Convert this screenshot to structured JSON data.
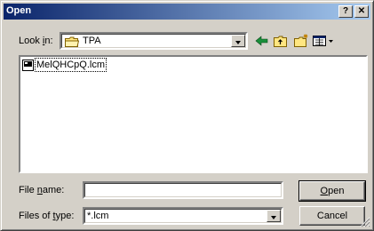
{
  "window": {
    "title": "Open"
  },
  "lookin": {
    "label_prefix": "Look ",
    "label_ul": "i",
    "label_suffix": "n:",
    "value": "TPA"
  },
  "toolbar": {
    "back": "back-arrow",
    "up": "up-folder",
    "new_folder": "new-folder",
    "view": "view-menu"
  },
  "files": [
    {
      "name": "MelQHCpQ.lcm",
      "icon": "file"
    }
  ],
  "filename": {
    "label_prefix": "File ",
    "label_ul": "n",
    "label_suffix": "ame:",
    "value": ""
  },
  "filetype": {
    "label_prefix": "Files of ",
    "label_ul": "t",
    "label_suffix": "ype:",
    "value": "*.lcm"
  },
  "buttons": {
    "open_ul": "O",
    "open_rest": "pen",
    "cancel": "Cancel"
  }
}
